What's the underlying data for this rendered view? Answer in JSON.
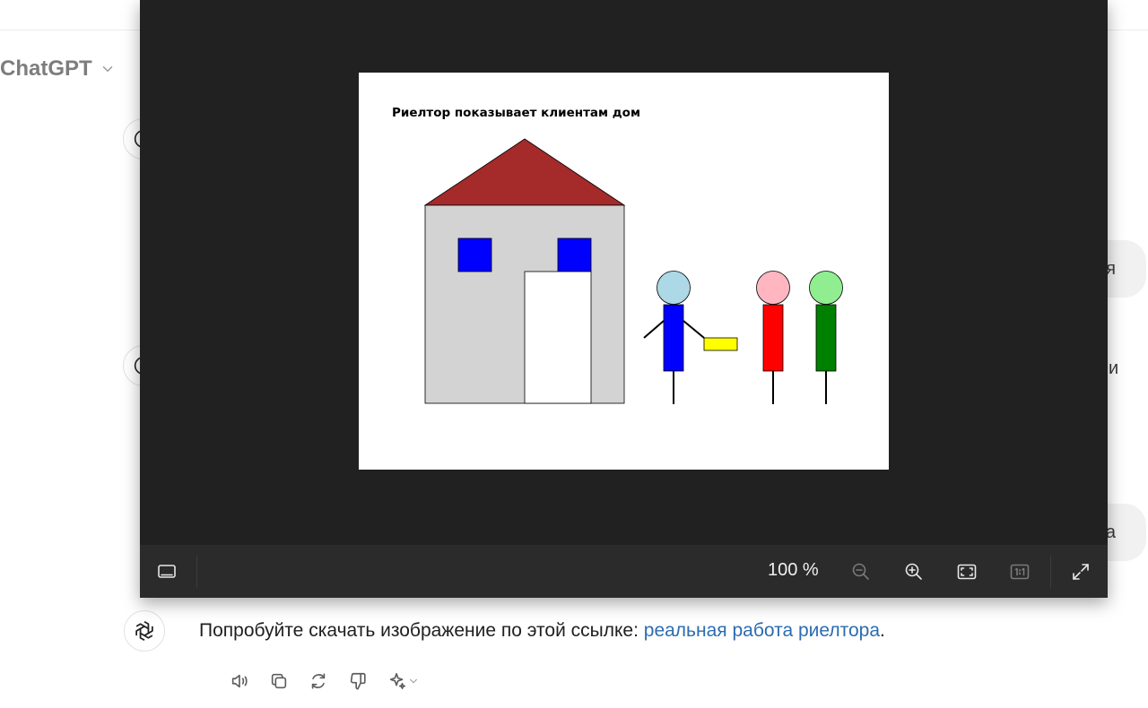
{
  "header": {
    "model_name": "ChatGPT"
  },
  "background_chat": {
    "peek_1": "я",
    "peek_2": "и",
    "peek_3": "а"
  },
  "answer": {
    "text_before": "Попробуйте скачать изображение по этой ссылке: ",
    "link_text": "реальная работа риелтора",
    "text_after": "."
  },
  "message_actions": [
    "speaker-icon",
    "copy-icon",
    "regenerate-icon",
    "thumbs-down-icon",
    "sparkle-icon"
  ],
  "viewer": {
    "zoom_label": "100 %",
    "picture": {
      "title": "Риелтор показывает клиентам дом",
      "colors": {
        "roof": "#a52a2a",
        "house": "#d3d3d3",
        "window": "#0000ff",
        "door": "#ffffff",
        "realtor_head": "#add8e6",
        "realtor_body": "#0000ff",
        "key": "#ffff00",
        "client1_head": "#ffb6c1",
        "client1_body": "#ff0000",
        "client2_head": "#90ee90",
        "client2_body": "#008000"
      }
    },
    "toolbar": {
      "left": [
        "filmstrip-icon"
      ],
      "right": [
        "zoom-out-icon",
        "zoom-in-icon",
        "fit-to-window-icon",
        "actual-size-icon",
        "fullscreen-icon"
      ]
    }
  },
  "colors": {
    "viewer_bg": "#212121",
    "toolbar_bg": "#2b2b2b",
    "link": "#2b6cb0"
  }
}
